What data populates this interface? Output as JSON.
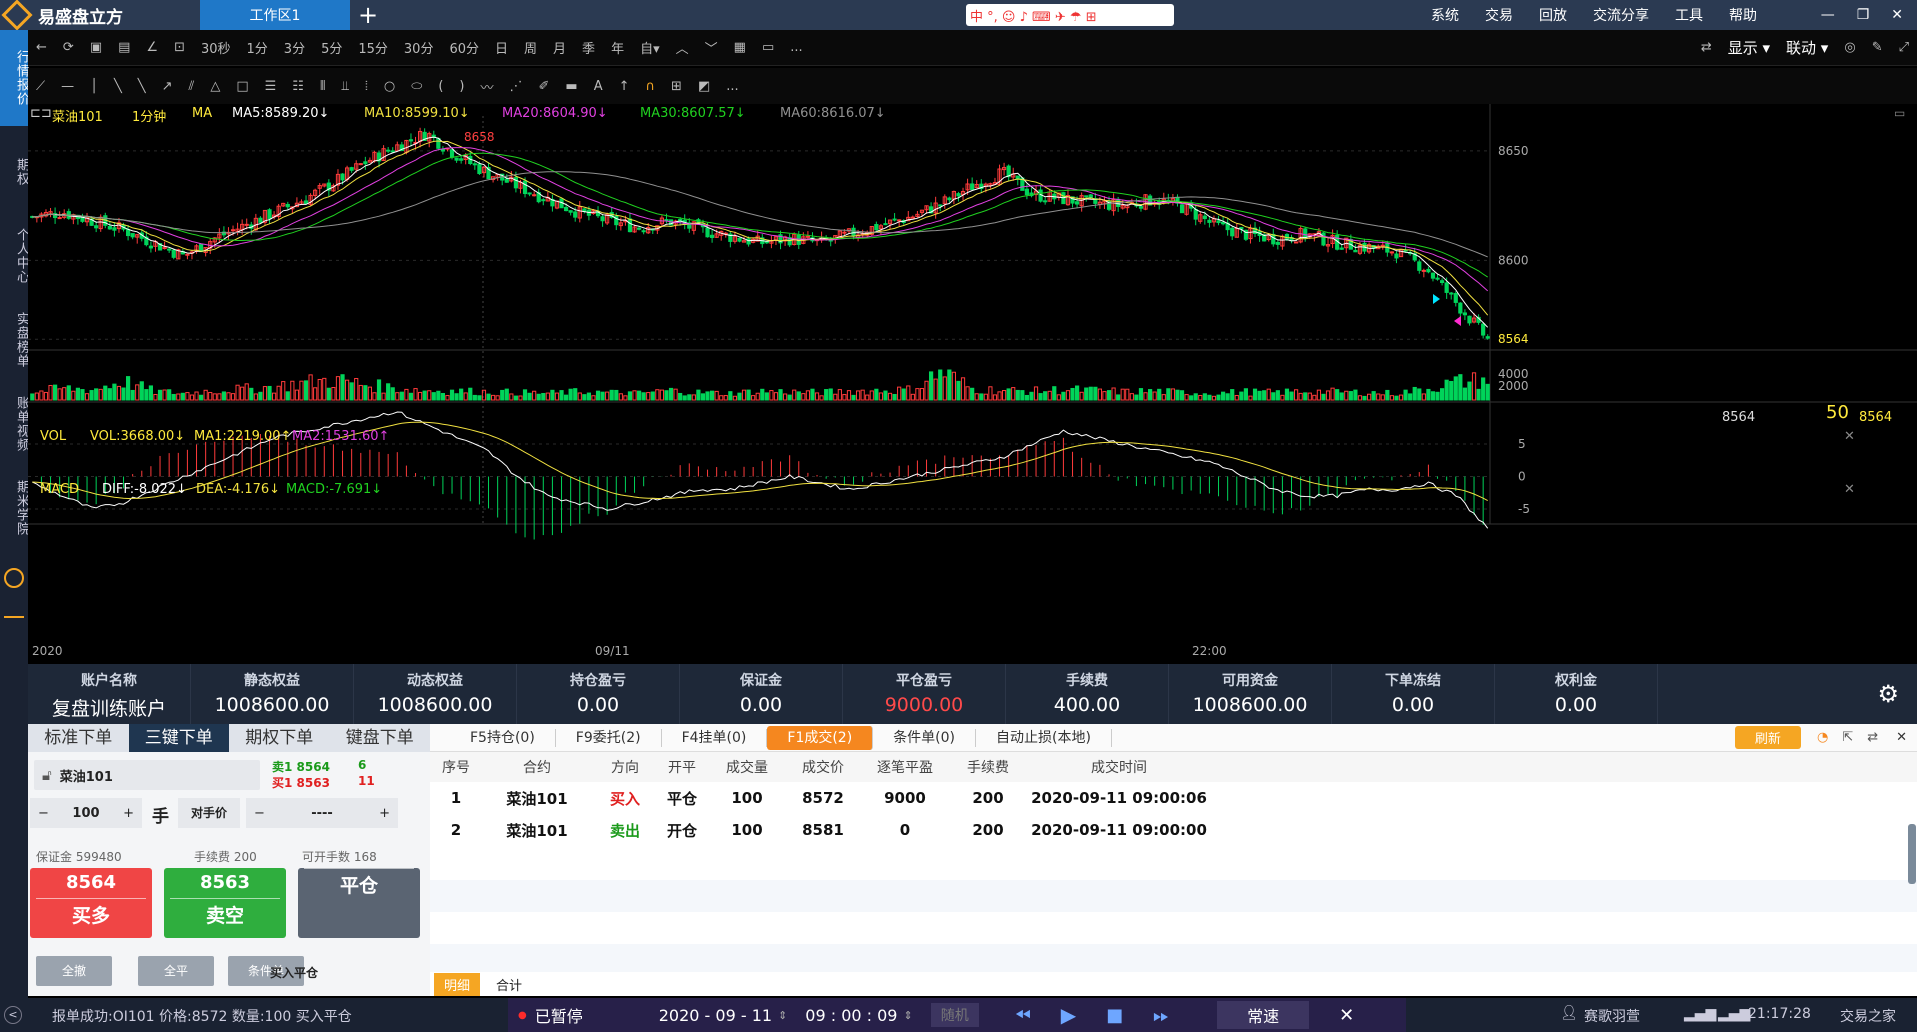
{
  "title_bar": {
    "app_name": "易盛盘立方",
    "workspace_tab": "工作区1",
    "add_tab": "+",
    "ime": "中 °, ☺ ♪ ⌨ ✈ ☂ ⊞",
    "menu": [
      "系统",
      "交易",
      "回放",
      "交流分享",
      "工具",
      "帮助"
    ],
    "window_buttons": [
      "—",
      "❐",
      "✕"
    ]
  },
  "left_nav": [
    "行情报价",
    "期权",
    "个人中心",
    "实盘榜单",
    "账单视频",
    "期米学院"
  ],
  "toolbar1": {
    "periods": [
      "30秒",
      "1分",
      "3分",
      "5分",
      "15分",
      "30分",
      "60分",
      "日",
      "周",
      "月",
      "季",
      "年",
      "自▾"
    ],
    "right": [
      "显示 ▾",
      "联动 ▾"
    ],
    "more": "..."
  },
  "toolbar2": {
    "more": "..."
  },
  "chart": {
    "symbol": "菜油101",
    "period": "1分钟",
    "indicator": "MA",
    "ma5": "MA5:8589.20↓",
    "ma10": "MA10:8599.10↓",
    "ma20": "MA20:8604.90↓",
    "ma30": "MA30:8607.57↓",
    "ma60": "MA60:8616.07↓",
    "high_label": "8658",
    "low_label": "8564",
    "right_price": "8564",
    "countdown": "50",
    "vol_head": {
      "name": "VOL",
      "vol": "VOL:3668.00↓",
      "ma1": "MA1:2219.00↑",
      "ma2": "MA2:1531.60↑"
    },
    "macd_head": {
      "name": "MACD",
      "diff": "DIFF:-8.022↓",
      "dea": "DEA:-4.176↓",
      "macd": "MACD:-7.691↓"
    },
    "time_labels": [
      "2020",
      "09/11",
      "22:00"
    ],
    "colors": {
      "up": "#ff3b3b",
      "down": "#00d45a",
      "ma5": "#ffffff",
      "ma10": "#f0e040",
      "ma20": "#e040e0",
      "ma30": "#20d020",
      "ma60": "#909090"
    }
  },
  "chart_data": {
    "type": "candlestick",
    "symbol": "菜油101",
    "period": "1分钟",
    "price_axis_ticks": [
      8650,
      8600,
      8564
    ],
    "ylim": [
      8560,
      8665
    ],
    "volume_axis_ticks": [
      4000,
      2000
    ],
    "macd_axis_ticks": [
      5,
      0,
      -5
    ],
    "x_labels": [
      "2020",
      "09/11",
      "22:00"
    ],
    "series": [
      {
        "name": "MA5",
        "last": 8589.2
      },
      {
        "name": "MA10",
        "last": 8599.1
      },
      {
        "name": "MA20",
        "last": 8604.9
      },
      {
        "name": "MA30",
        "last": 8607.57
      },
      {
        "name": "MA60",
        "last": 8616.07
      }
    ],
    "close_path": [
      8620,
      8622,
      8618,
      8614,
      8608,
      8602,
      8610,
      8616,
      8622,
      8628,
      8636,
      8645,
      8652,
      8658,
      8648,
      8640,
      8634,
      8628,
      8622,
      8618,
      8615,
      8618,
      8614,
      8611,
      8608,
      8610,
      8608,
      8612,
      8616,
      8620,
      8626,
      8634,
      8640,
      8630,
      8628,
      8626,
      8625,
      8628,
      8624,
      8616,
      8612,
      8610,
      8612,
      8608,
      8606,
      8604,
      8596,
      8580,
      8564
    ],
    "volume_path": [
      1000,
      1600,
      1400,
      2600,
      1200,
      900,
      1300,
      1500,
      1800,
      2400,
      2800,
      2100,
      1600,
      1300,
      1200,
      1100,
      1000,
      900,
      1100,
      1000,
      900,
      1300,
      1000,
      900,
      1200,
      1100,
      1000,
      1200,
      1300,
      1400,
      4000,
      1500,
      1300,
      1200,
      1400,
      1300,
      1100,
      1200,
      1000,
      900,
      1100,
      1000,
      1200,
      1100,
      1000,
      900,
      1500,
      2500,
      2800
    ],
    "macd_dif_path": [
      -1,
      -3,
      -5,
      -4,
      -2,
      0,
      2,
      4,
      6,
      7,
      8,
      9,
      10,
      8,
      6,
      4,
      0,
      -3,
      -4,
      -5,
      -4,
      -3,
      -2,
      -2,
      -1,
      0,
      -1,
      -2,
      -1,
      0,
      1,
      2,
      3,
      5,
      7,
      6,
      5,
      4,
      3,
      2,
      0,
      -2,
      -3,
      -3,
      -2,
      -2,
      -1,
      -3,
      -8
    ]
  },
  "account": {
    "headers": [
      "账户名称",
      "静态权益",
      "动态权益",
      "持仓盈亏",
      "保证金",
      "平仓盈亏",
      "手续费",
      "可用资金",
      "下单冻结",
      "权利金"
    ],
    "values": [
      "复盘训练账户",
      "1008600.00",
      "1008600.00",
      "0.00",
      "0.00",
      "9000.00",
      "400.00",
      "1008600.00",
      "0.00",
      "0.00"
    ]
  },
  "order": {
    "tabs": [
      "标准下单",
      "三键下单",
      "期权下单",
      "键盘下单"
    ],
    "contract": "菜油101",
    "sell1_label": "卖1",
    "sell1_price": "8564",
    "sell1_qty": "6",
    "buy1_label": "买1",
    "buy1_price": "8563",
    "buy1_qty": "11",
    "qty": "100",
    "unit": "手",
    "price_mode": "对手价",
    "price_value": "----",
    "margin": "保证金 599480",
    "fee": "手续费 200",
    "openable": "可开手数 168",
    "buy_price": "8564",
    "buy_label": "买多",
    "sell_price": "8563",
    "sell_label": "卖空",
    "close_label": "平仓",
    "cancel_all": "全撤",
    "close_all": "全平",
    "cond_order": "条件单",
    "hint": "买入平仓"
  },
  "trades": {
    "tabs": [
      "F5持仓(0)",
      "F9委托(2)",
      "F4挂单(0)",
      "F1成交(2)",
      "条件单(0)",
      "自动止损(本地)"
    ],
    "refresh": "刷新",
    "columns": [
      "序号",
      "合约",
      "方向",
      "开平",
      "成交量",
      "成交价",
      "逐笔平盈",
      "手续费",
      "成交时间"
    ],
    "rows": [
      [
        "1",
        "菜油101",
        "买入",
        "平仓",
        "100",
        "8572",
        "9000",
        "200",
        "2020-09-11 09:00:06"
      ],
      [
        "2",
        "菜油101",
        "卖出",
        "开仓",
        "100",
        "8581",
        "0",
        "200",
        "2020-09-11 09:00:00"
      ]
    ],
    "bottom_tabs": [
      "明细",
      "合计"
    ]
  },
  "status": {
    "message": "报单成功:OI101 价格:8572 数量:100 买入平仓",
    "paused": "已暂停",
    "date": "2020 - 09 - 11",
    "time": "09 : 00 : 09",
    "random": "随机",
    "speed": "常速",
    "user": "赛歌羽萱",
    "clock": "21:17:28",
    "brand": "交易之家"
  }
}
